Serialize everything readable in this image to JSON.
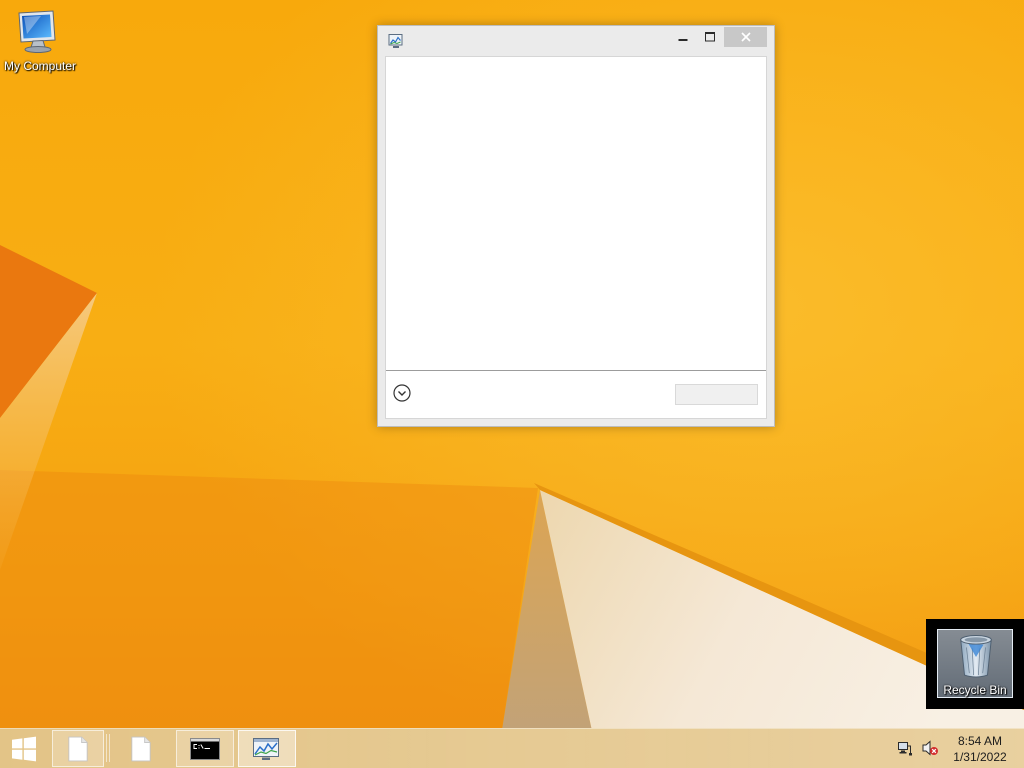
{
  "desktop": {
    "computer": {
      "label": "My Computer",
      "icon": "computer-icon"
    },
    "recycle_bin": {
      "label": "Recycle Bin",
      "icon": "recycle-bin-icon",
      "selected": true
    }
  },
  "window": {
    "app_icon": "performance-monitor-icon",
    "controls": {
      "minimize": "minimize-icon",
      "maximize": "maximize-icon",
      "close": "close-icon"
    },
    "footer": {
      "expand_icon": "chevron-down-icon",
      "button_enabled": false
    }
  },
  "taskbar": {
    "start_icon": "windows-logo-icon",
    "items": [
      {
        "icon": "document-icon",
        "highlighted": true,
        "active": false
      },
      {
        "icon": "document-icon",
        "highlighted": false,
        "active": false
      },
      {
        "icon": "command-prompt-icon",
        "highlighted": true,
        "active": false
      },
      {
        "icon": "performance-monitor-icon",
        "highlighted": true,
        "active": true
      }
    ],
    "tray": {
      "network_icon": "network-icon",
      "volume_icon": "volume-muted-icon"
    },
    "clock": {
      "time": "8:54 AM",
      "date": "1/31/2022"
    }
  },
  "colors": {
    "wallpaper": "#f7a90d",
    "taskbar": "#e3c487",
    "window_frame": "#ebebeb",
    "close_button": "#c8c8c8",
    "selection": "#c8d7e6"
  }
}
